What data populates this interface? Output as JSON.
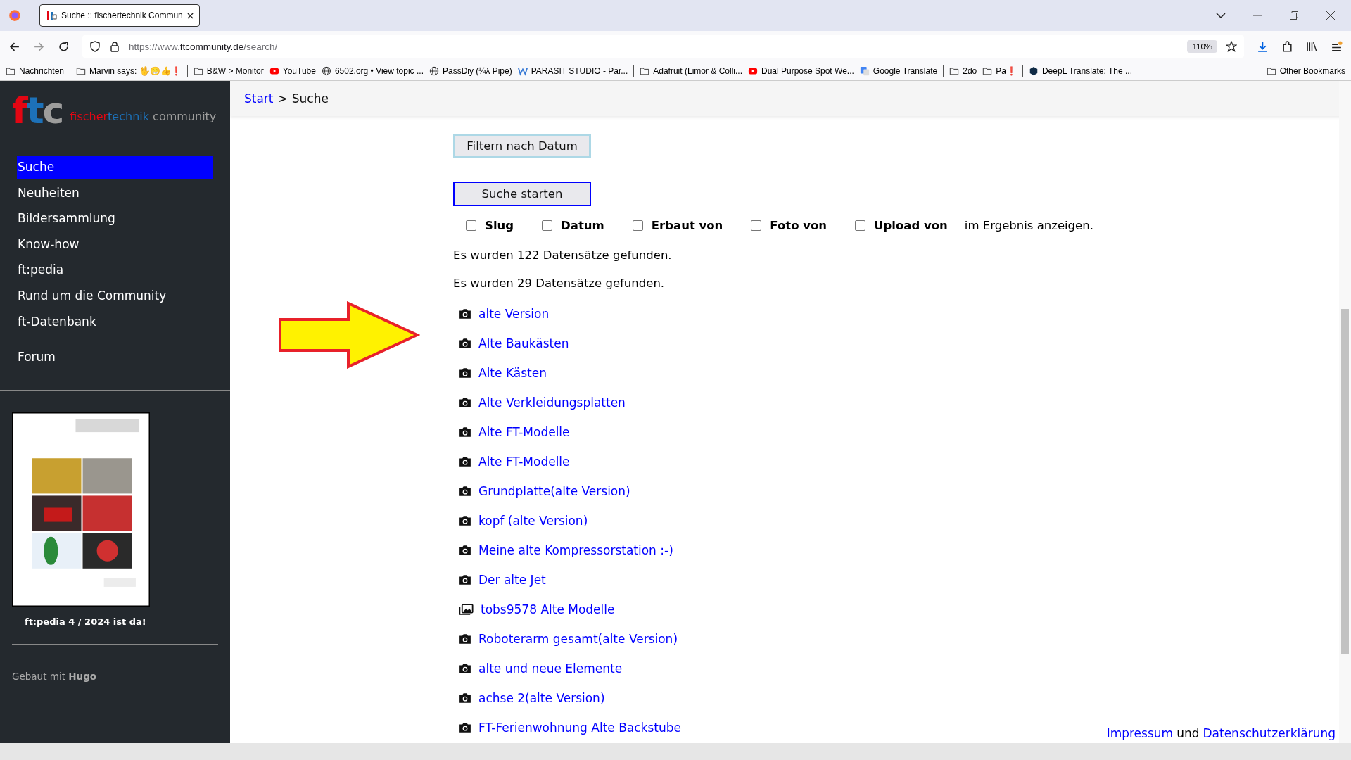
{
  "browser": {
    "tab_title": "Suche :: fischertechnik Commun",
    "url": {
      "prefix": "https://www.",
      "host": "ftcommunity.de",
      "path": "/search/"
    },
    "zoom": "110%",
    "bookmark_groups": [
      [
        {
          "kind": "folder",
          "label": "Nachrichten"
        }
      ],
      [
        {
          "kind": "folder",
          "label": "Marvin says: 🖖😁👍❗"
        }
      ],
      [
        {
          "kind": "folder",
          "label": "B&W > Monitor"
        },
        {
          "kind": "youtube",
          "label": "YouTube"
        },
        {
          "kind": "globe",
          "label": "6502.org • View topic ..."
        },
        {
          "kind": "globe",
          "label": "PassDiy (¼λ Pipe)"
        },
        {
          "kind": "w",
          "label": "PARASIT STUDIO - Par..."
        }
      ],
      [
        {
          "kind": "folder",
          "label": "Adafruit (Limor & Colli..."
        },
        {
          "kind": "youtube",
          "label": "Dual Purpose Spot We..."
        },
        {
          "kind": "translate",
          "label": "Google Translate"
        }
      ],
      [
        {
          "kind": "folder",
          "label": "2do"
        },
        {
          "kind": "folder",
          "label": "Pa❗"
        }
      ],
      [
        {
          "kind": "deepl",
          "label": "DeepL Translate: The ..."
        }
      ]
    ],
    "other_bookmarks": "Other Bookmarks"
  },
  "sidebar": {
    "logo": {
      "mark": "ftc",
      "word1": "fischer",
      "word2": "technik",
      "word3": "community"
    },
    "nav": [
      {
        "label": "Suche",
        "selected": true
      },
      {
        "label": "Neuheiten",
        "selected": false
      },
      {
        "label": "Bildersammlung",
        "selected": false
      },
      {
        "label": "Know-how",
        "selected": false
      },
      {
        "label": "ft:pedia",
        "selected": false
      },
      {
        "label": "Rund um die Community",
        "selected": false
      },
      {
        "label": "ft-Datenbank",
        "selected": false
      },
      {
        "label": "Forum",
        "selected": false
      }
    ],
    "promo": {
      "caption": "ft:pedia 4 / 2024 ist da!"
    },
    "built_with": "Gebaut mit **Hugo**"
  },
  "breadcrumb": {
    "link": "Start",
    "separator": ">",
    "current": "Suche"
  },
  "filter_button": "Filtern nach Datum",
  "search_button": "Suche starten",
  "options": [
    {
      "label": "Slug",
      "checked": false
    },
    {
      "label": "Datum",
      "checked": false
    },
    {
      "label": "Erbaut von",
      "checked": false
    },
    {
      "label": "Foto von",
      "checked": false
    },
    {
      "label": "Upload von",
      "checked": false
    }
  ],
  "options_suffix": "im Ergebnis anzeigen.",
  "messages": [
    "Es wurden 122 Datensätze gefunden.",
    "Es wurden 29 Datensätze gefunden."
  ],
  "results": [
    {
      "title": "alte Version"
    },
    {
      "title": "Alte Baukästen"
    },
    {
      "title": "Alte Kästen"
    },
    {
      "title": "Alte Verkleidungsplatten"
    },
    {
      "title": "Alte FT-Modelle"
    },
    {
      "title": "Alte FT-Modelle"
    },
    {
      "title": "Grundplatte(alte Version)"
    },
    {
      "title": "kopf (alte Version)"
    },
    {
      "title": "Meine alte Kompressorstation :-)"
    },
    {
      "title": "Der alte Jet"
    },
    {
      "kind": "gallery",
      "title": "tobs9578 Alte Modelle"
    },
    {
      "title": "Roboterarm gesamt(alte Version)"
    },
    {
      "title": "alte und neue Elemente"
    },
    {
      "title": "achse 2(alte Version)"
    },
    {
      "title": "FT-Ferienwohnung Alte Backstube"
    }
  ],
  "footer": {
    "link1": "Impressum",
    "joiner": "und",
    "link2": "Datenschutzerklärung"
  }
}
